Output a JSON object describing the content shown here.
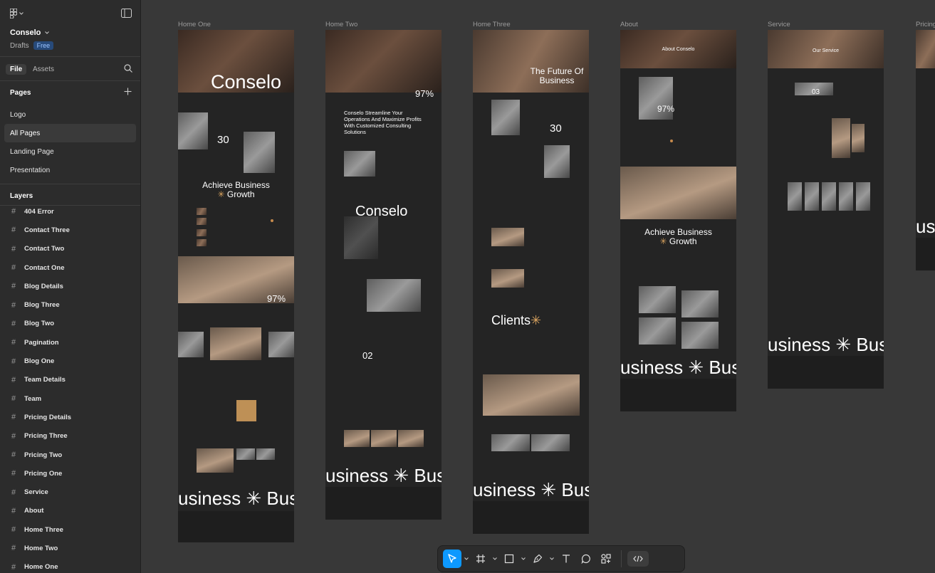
{
  "project": {
    "name": "Conselo",
    "drafts_label": "Drafts",
    "plan_badge": "Free"
  },
  "tabs": {
    "file": "File",
    "assets": "Assets"
  },
  "pages": {
    "title": "Pages",
    "items": [
      "Logo",
      "All Pages",
      "Landing Page",
      "Presentation"
    ],
    "active": "All Pages"
  },
  "layers": {
    "title": "Layers",
    "items": [
      "404 Error",
      "Contact Three",
      "Contact Two",
      "Contact One",
      "Blog Details",
      "Blog Three",
      "Blog Two",
      "Pagination",
      "Blog One",
      "Team Details",
      "Team",
      "Pricing Details",
      "Pricing Three",
      "Pricing Two",
      "Pricing One",
      "Service",
      "About",
      "Home Three",
      "Home Two",
      "Home One"
    ]
  },
  "frames": [
    {
      "label": "Home One",
      "headline": "Conselo",
      "mid_text": "Achieve Business",
      "mid_text2": "Growth",
      "stat1": "30",
      "stat2": "97%",
      "band_text": "usiness ✳ Bus"
    },
    {
      "label": "Home Two",
      "headline": "Conselo Streamline Your Operations And Maximize Profits With Customized Consulting Solutions",
      "mid_text": "Conselo",
      "stat1": "97%",
      "stat2": "02",
      "band_text": "usiness ✳ Bus"
    },
    {
      "label": "Home Three",
      "headline": "The Future Of Business",
      "mid_text": "Clients",
      "stat1": "30",
      "band_text": "usiness ✳ Bus"
    },
    {
      "label": "About",
      "headline": "About Conselo",
      "mid_text": "Achieve Business",
      "mid_text2": "Growth",
      "stat1": "97%",
      "band_text": "usiness ✳ Bus"
    },
    {
      "label": "Service",
      "headline": "Our Service",
      "stat1": "03",
      "band_text": "usiness ✳ Bus"
    },
    {
      "label": "Pricing",
      "band_text": "us"
    }
  ],
  "colors": {
    "accent": "#d9a35f",
    "selection": "#0d99ff",
    "sidebar": "#2c2c2c",
    "canvas": "#383838"
  },
  "toolbar": {
    "icons": [
      "move-tool-icon",
      "frame-tool-icon",
      "shape-tool-icon",
      "pen-tool-icon",
      "text-tool-icon",
      "comment-tool-icon",
      "actions-icon",
      "dev-mode-icon"
    ]
  }
}
